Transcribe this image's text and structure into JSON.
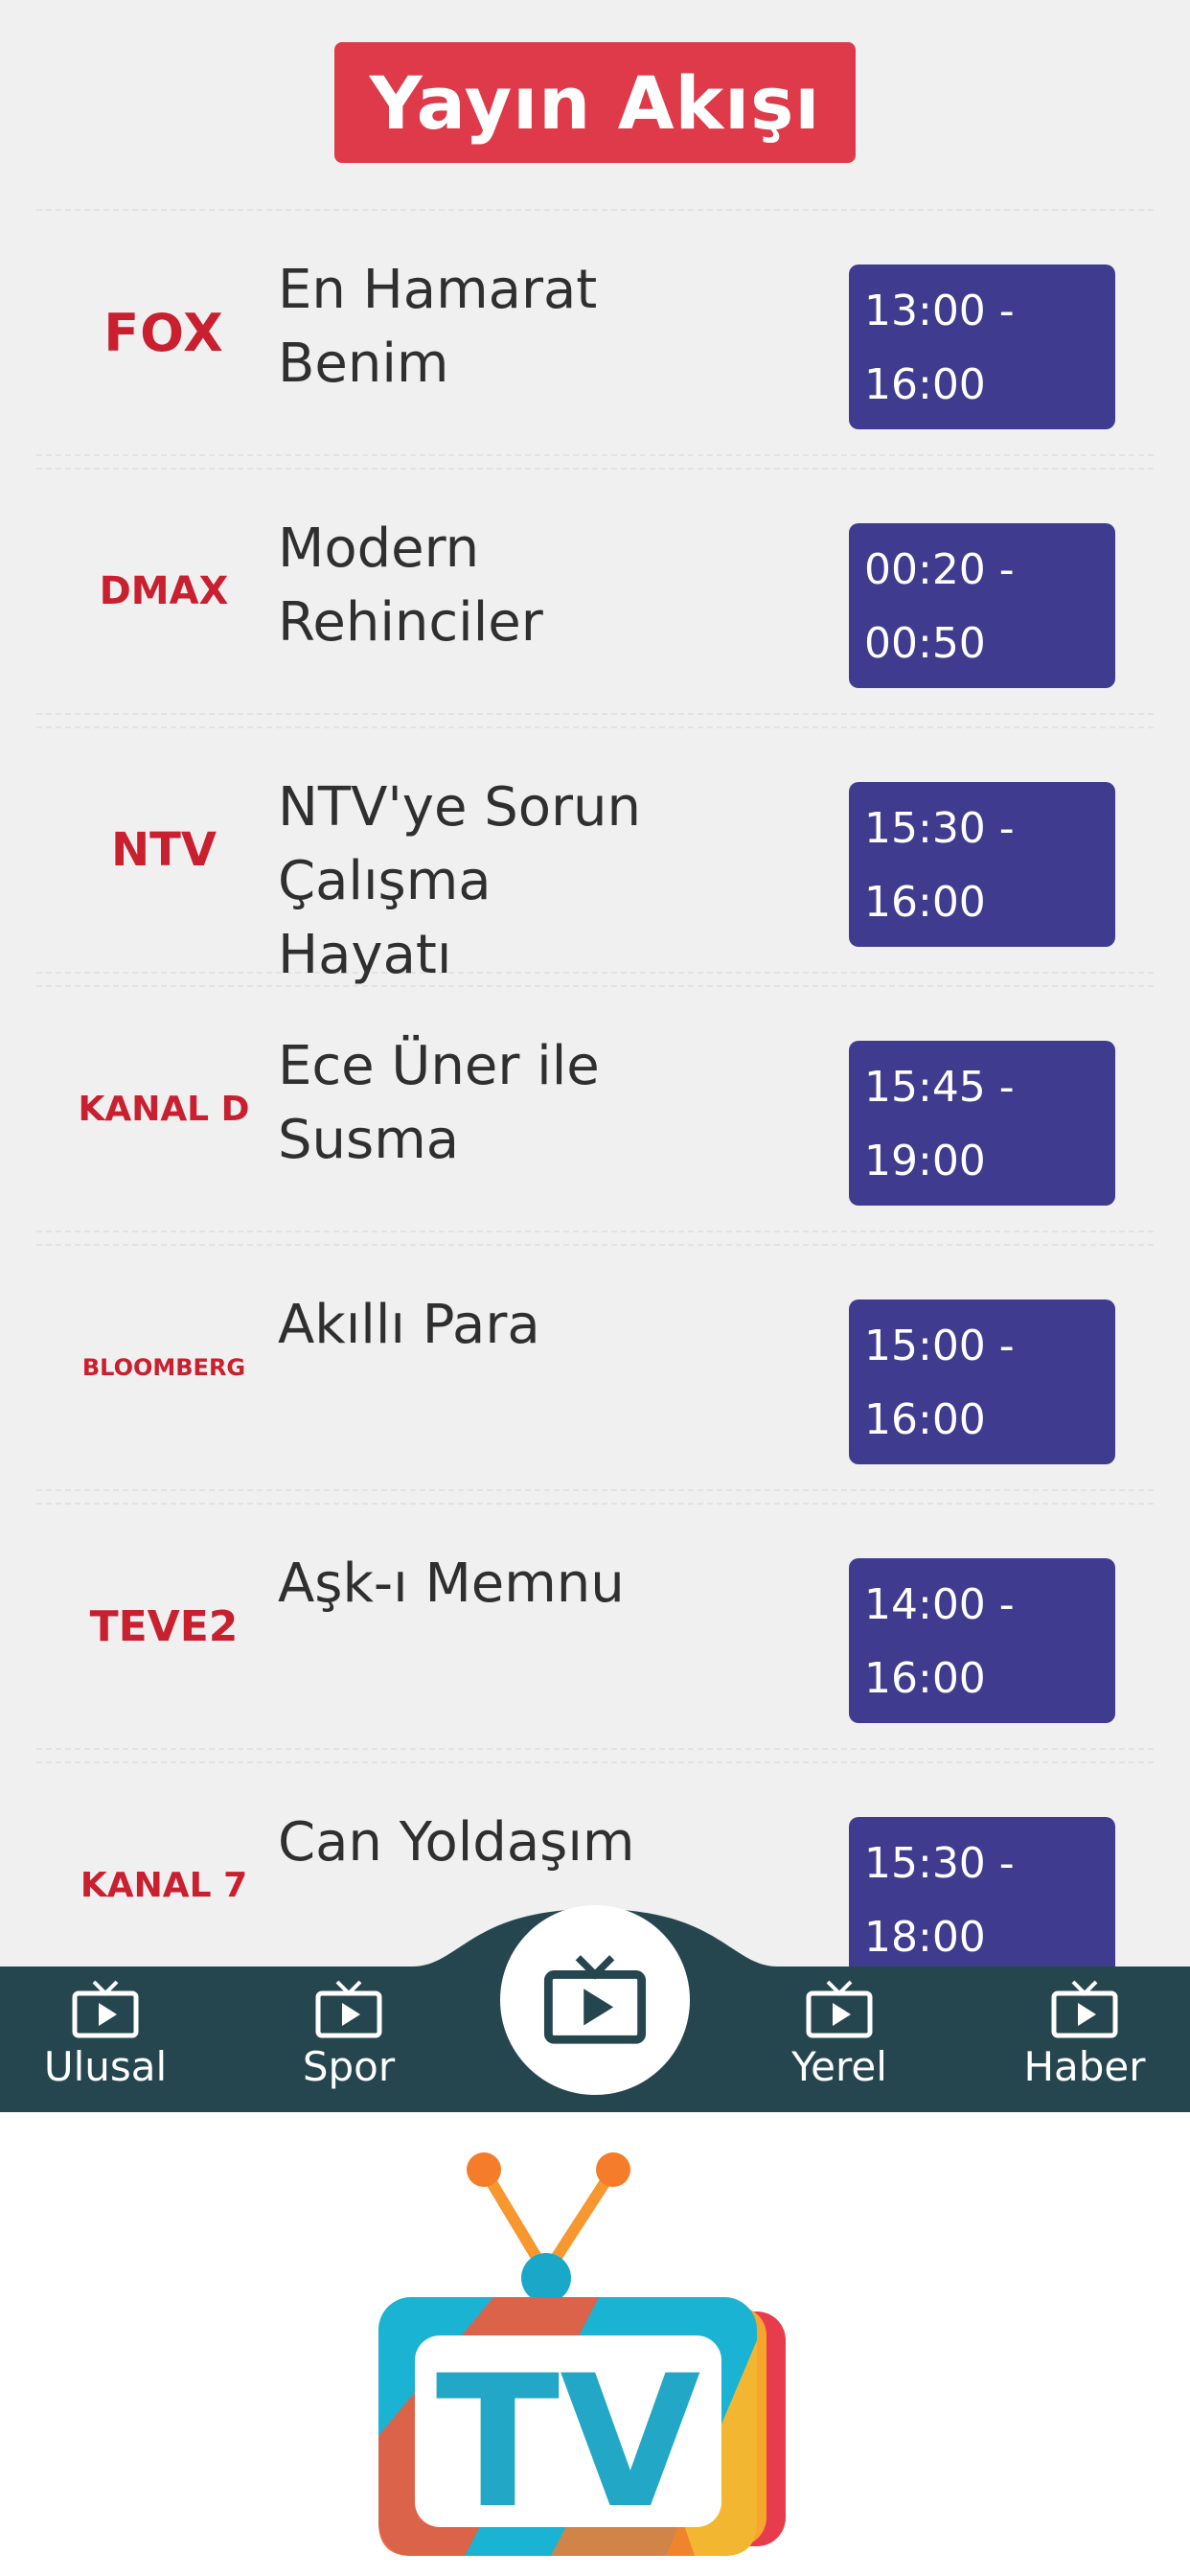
{
  "header": {
    "title": "Yayın Akışı"
  },
  "schedule": [
    {
      "channel": "FOX",
      "program": "En Hamarat Benim",
      "time": "13:00 -\n16:00"
    },
    {
      "channel": "DMAX",
      "program": "Modern Rehinciler",
      "time": "00:20 -\n00:50"
    },
    {
      "channel": "NTV",
      "program": "NTV'ye Sorun Çalışma Hayatı",
      "time": "15:30 -\n16:00"
    },
    {
      "channel": "KANAL D",
      "program": "Ece Üner ile Susma",
      "time": "15:45 -\n19:00"
    },
    {
      "channel": "BLOOMBERG",
      "program": "Akıllı Para",
      "time": "15:00 -\n16:00"
    },
    {
      "channel": "TEVE2",
      "program": "Aşk-ı Memnu",
      "time": "14:00 -\n16:00"
    },
    {
      "channel": "KANAL 7",
      "program": "Can Yoldaşım",
      "time": "15:30 -\n18:00"
    }
  ],
  "tabs": {
    "ulusal": "Ulusal",
    "spor": "Spor",
    "yerel": "Yerel",
    "haber": "Haber"
  },
  "center_tab_icon": "tv-play-icon",
  "brand_logo": {
    "text": "TV",
    "icon": "tv-logo-icon"
  },
  "colors": {
    "title_bg": "#de3a49",
    "channel_red": "#c8202f",
    "time_bg": "#3f3c90",
    "tabbar_bg": "#26464f"
  }
}
